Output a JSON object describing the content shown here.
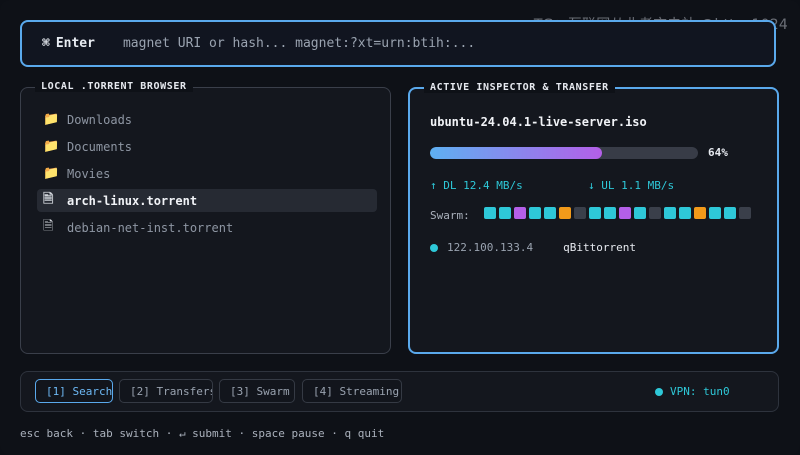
{
  "watermark": "TG：互联网从业者充电站 @https1024",
  "command": {
    "key_icon": "⌘",
    "key_label": "Enter",
    "placeholder": "magnet URI or hash... magnet:?xt=urn:btih:..."
  },
  "browser": {
    "title": "LOCAL .TORRENT BROWSER",
    "items": [
      {
        "label": "Downloads",
        "icon": "folder-icon"
      },
      {
        "label": "Documents",
        "icon": "folder-icon"
      },
      {
        "label": "Movies",
        "icon": "folder-icon"
      },
      {
        "label": "arch-linux.torrent",
        "icon": "file-icon",
        "selected": true
      },
      {
        "label": "debian-net-inst.torrent",
        "icon": "file-icon"
      }
    ]
  },
  "inspector": {
    "title": "ACTIVE INSPECTOR & TRANSFER",
    "torrent_name": "ubuntu-24.04.1-live-server.iso",
    "progress": 64,
    "progress_label": "64%",
    "download": "↑ DL 12.4 MB/s",
    "upload": "↓ UL 1.1 MB/s",
    "swarm_label": "Swarm:",
    "swarm_cells": [
      "#2ec8d8",
      "#2ec8d8",
      "#b45fe8",
      "#2ec8d8",
      "#2ec8d8",
      "#f29a1a",
      "#3a3f4a",
      "#2ec8d8",
      "#2ec8d8",
      "#b45fe8",
      "#2ec8d8",
      "#3a3f4a",
      "#2ec8d8",
      "#2ec8d8",
      "#f29a1a",
      "#2ec8d8",
      "#2ec8d8",
      "#3a3f4a"
    ],
    "peer_ip": "122.100.133.4",
    "peer_client": "qBittorrent"
  },
  "tabs": [
    {
      "label": "[1] Search",
      "active": true
    },
    {
      "label": "[2] Transfers",
      "active": false
    },
    {
      "label": "[3] Swarm",
      "active": false
    },
    {
      "label": "[4] Streaming",
      "active": false
    }
  ],
  "vpn_status": "VPN: tun0",
  "help_text": "esc back · tab switch · ↵ submit · space pause · q quit",
  "colors": {
    "accent": "#5aa9ec",
    "cyan": "#2ec8d8",
    "purple": "#b45fe8",
    "orange": "#f29a1a"
  }
}
